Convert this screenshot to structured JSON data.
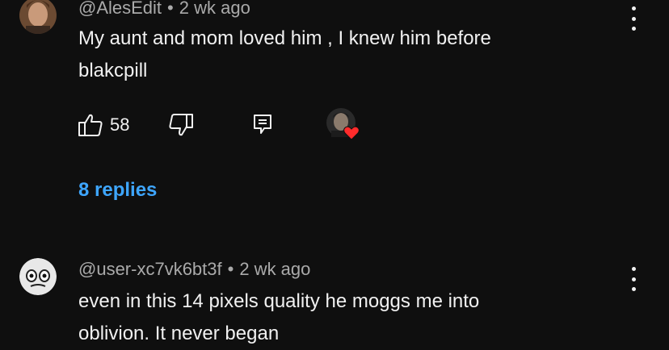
{
  "comments": [
    {
      "username": "@AlesEdit",
      "separator": "•",
      "time": "2 wk ago",
      "text_line1": "My aunt and mom loved him , I knew him before",
      "text_line2": "blakcpill",
      "likes": "58",
      "replies_label": "8 replies",
      "hearted": true
    },
    {
      "username": "@user-xc7vk6bt3f",
      "separator": "•",
      "time": "2 wk ago",
      "text_line1": "even in this 14 pixels quality he moggs me into",
      "text_line2": "oblivion. It never began"
    }
  ],
  "icons": {
    "like": "thumbs-up-icon",
    "dislike": "thumbs-down-icon",
    "reply": "reply-icon",
    "more": "more-vert-icon",
    "heart": "heart-icon"
  },
  "colors": {
    "background": "#0f0f0f",
    "text": "#f1f1f1",
    "meta": "#aaaaaa",
    "link": "#3ea6ff",
    "heart": "#ff2b2b"
  }
}
